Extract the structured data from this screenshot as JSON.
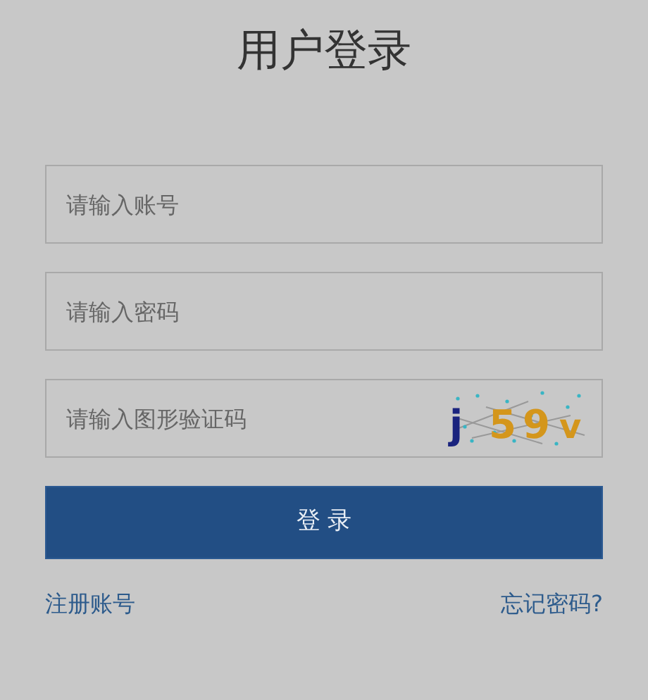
{
  "title": "用户登录",
  "fields": [
    {
      "placeholder": "请输入账号",
      "kind": "text"
    },
    {
      "placeholder": "请输入密码",
      "kind": "password"
    },
    {
      "placeholder": "请输入图形验证码",
      "kind": "captcha"
    }
  ],
  "captcha": {
    "characters": [
      "j",
      "5",
      "9",
      "v"
    ]
  },
  "login_button": "登 录",
  "links": [
    "注册账号",
    "忘记密码?"
  ]
}
